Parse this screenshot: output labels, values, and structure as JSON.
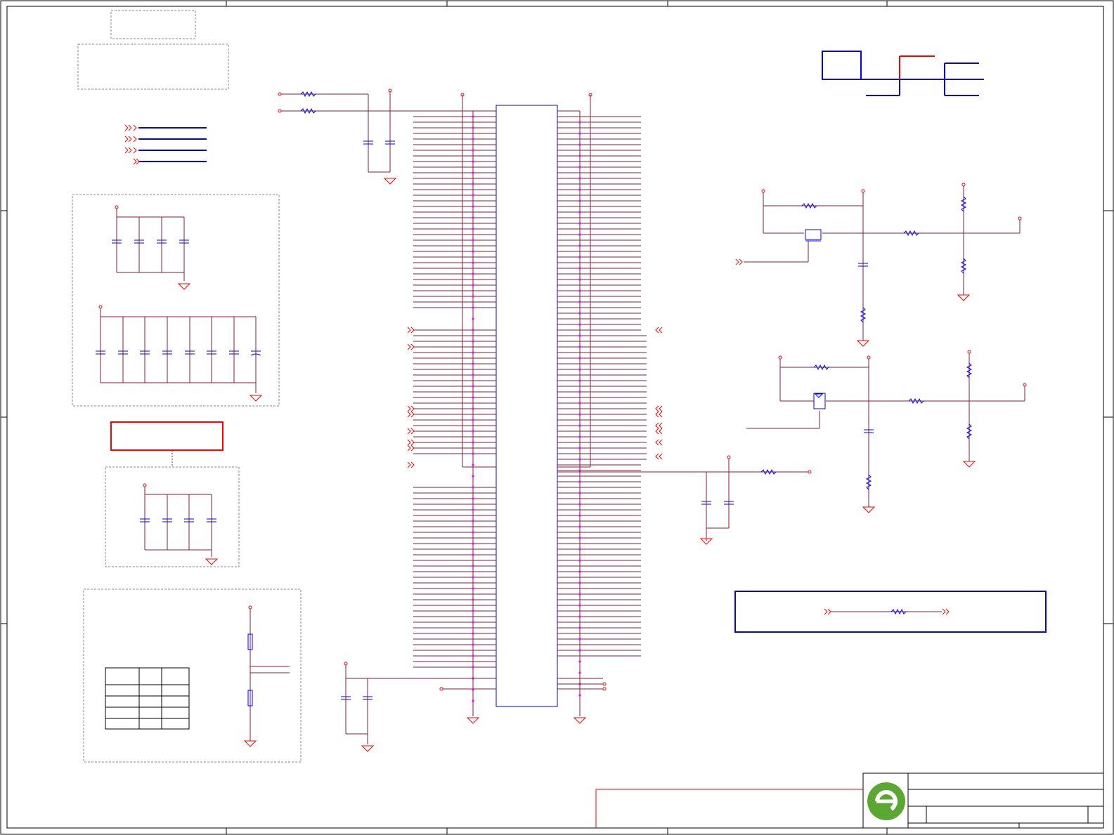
{
  "sheet": {
    "background": "#ffffff",
    "colors": {
      "border": "#000000",
      "wire": "#8b1a3a",
      "wire_red": "#ff0000",
      "component": "#0000ff",
      "junction": "#ff00ff",
      "dashed_box": "#888888",
      "logo": "#5aa832"
    },
    "zones": [
      "top-left-text-boxes",
      "decoupling-capacitor-bank",
      "main-ic-connector",
      "mosfet-power-switch-1",
      "mosfet-power-switch-2",
      "resistor-divider-table",
      "title-block"
    ],
    "ic_label": "",
    "title_block": {
      "logo_icon": "company-logo-icon",
      "title": "",
      "sheet_number": ""
    }
  }
}
